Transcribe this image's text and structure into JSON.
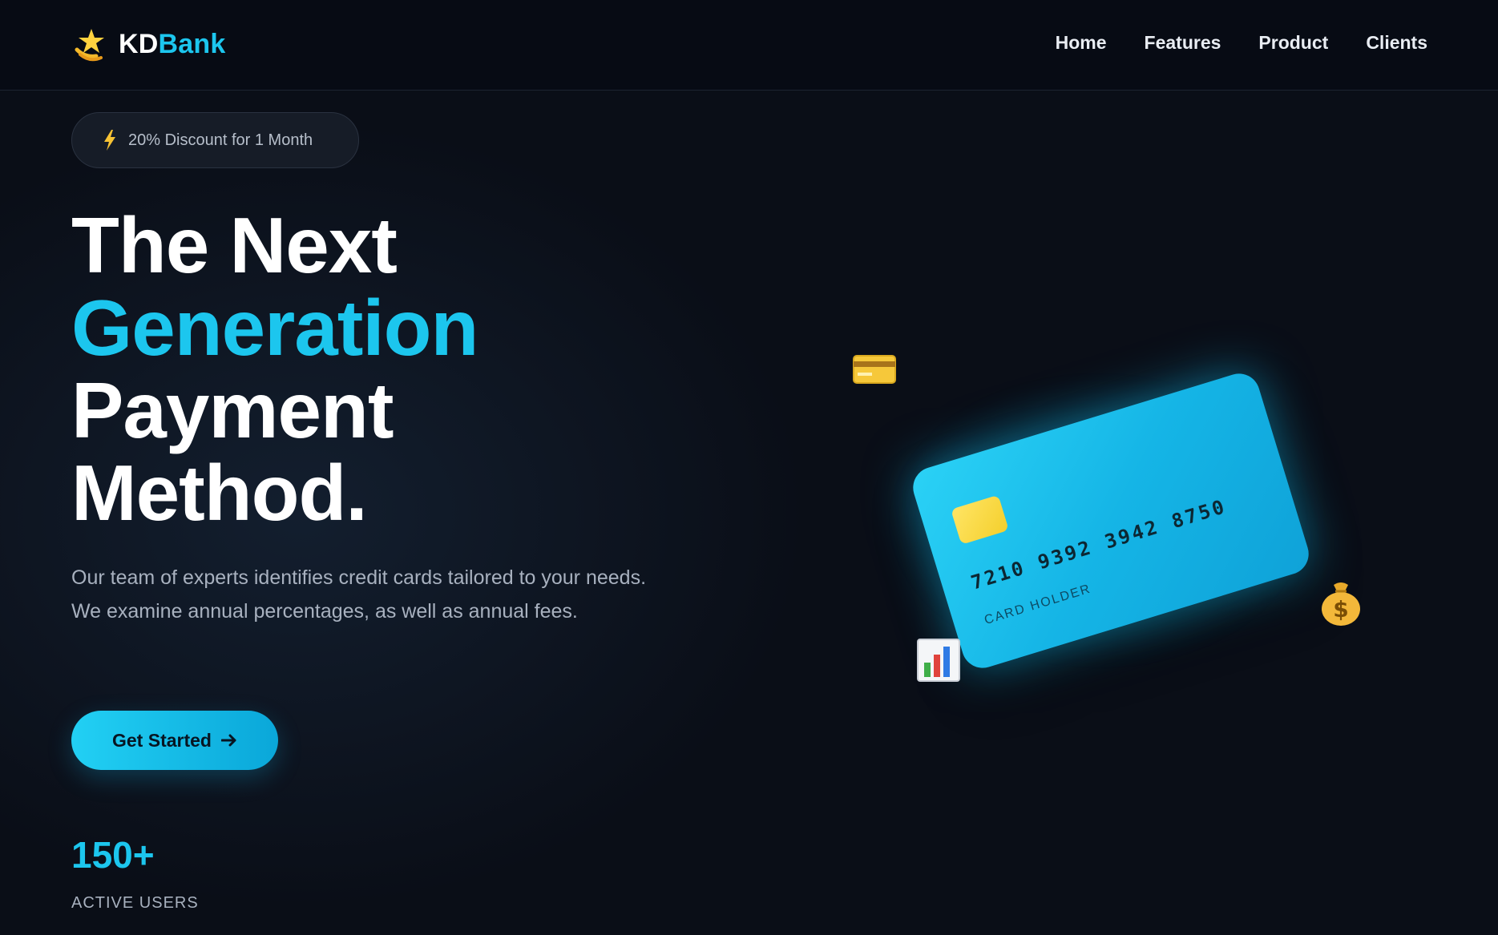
{
  "navbar": {
    "brand": {
      "kd": "KD",
      "bank": "Bank",
      "logo_icon": "shooting-star-icon"
    },
    "links": [
      {
        "label": "Home"
      },
      {
        "label": "Features"
      },
      {
        "label": "Product"
      },
      {
        "label": "Clients"
      }
    ]
  },
  "hero": {
    "promo": {
      "icon": "lightning-bolt-icon",
      "text": "20% Discount for 1 Month"
    },
    "headline": {
      "line1": "The Next",
      "line2": "Generation",
      "line3": "Payment",
      "line4": "Method."
    },
    "description": "Our team of experts identifies credit cards tailored to your needs. We examine annual percentages, as well as annual fees.",
    "cta": {
      "label": "Get Started",
      "icon": "arrow-right-icon"
    },
    "stat": {
      "value": "150+",
      "label": "ACTIVE USERS"
    }
  },
  "card": {
    "number": "7210 9392 3942 8750",
    "holder": "CARD HOLDER",
    "floating_icons": [
      "credit-card-icon",
      "bar-chart-icon",
      "money-bag-icon"
    ]
  },
  "colors": {
    "background": "#0a0e17",
    "navbar": "#070b14",
    "accent": "#1cc6ee",
    "card": "#15b5e6",
    "chip": "#f4cf2c",
    "text_muted": "#a8b1bf"
  }
}
